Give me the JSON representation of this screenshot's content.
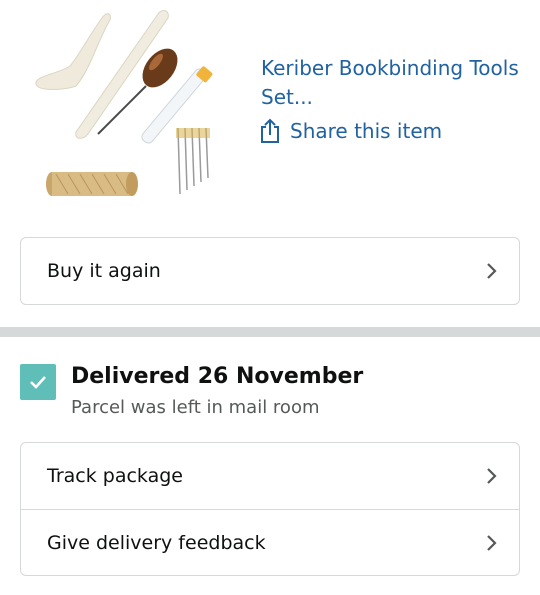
{
  "product": {
    "title": "Keriber Bookbinding Tools Set...",
    "share_label": "Share this item",
    "image_alt": "Bookbinding tools: bone folders, awl, needles and waxed thread"
  },
  "buy_again": {
    "label": "Buy it again"
  },
  "delivery": {
    "title": "Delivered 26 November",
    "subtitle": "Parcel was left in mail room",
    "status_color": "#5fbfb8"
  },
  "actions": [
    {
      "label": "Track package"
    },
    {
      "label": "Give delivery feedback"
    }
  ],
  "colors": {
    "link": "#2162a1",
    "divider": "#d5d9d9"
  }
}
